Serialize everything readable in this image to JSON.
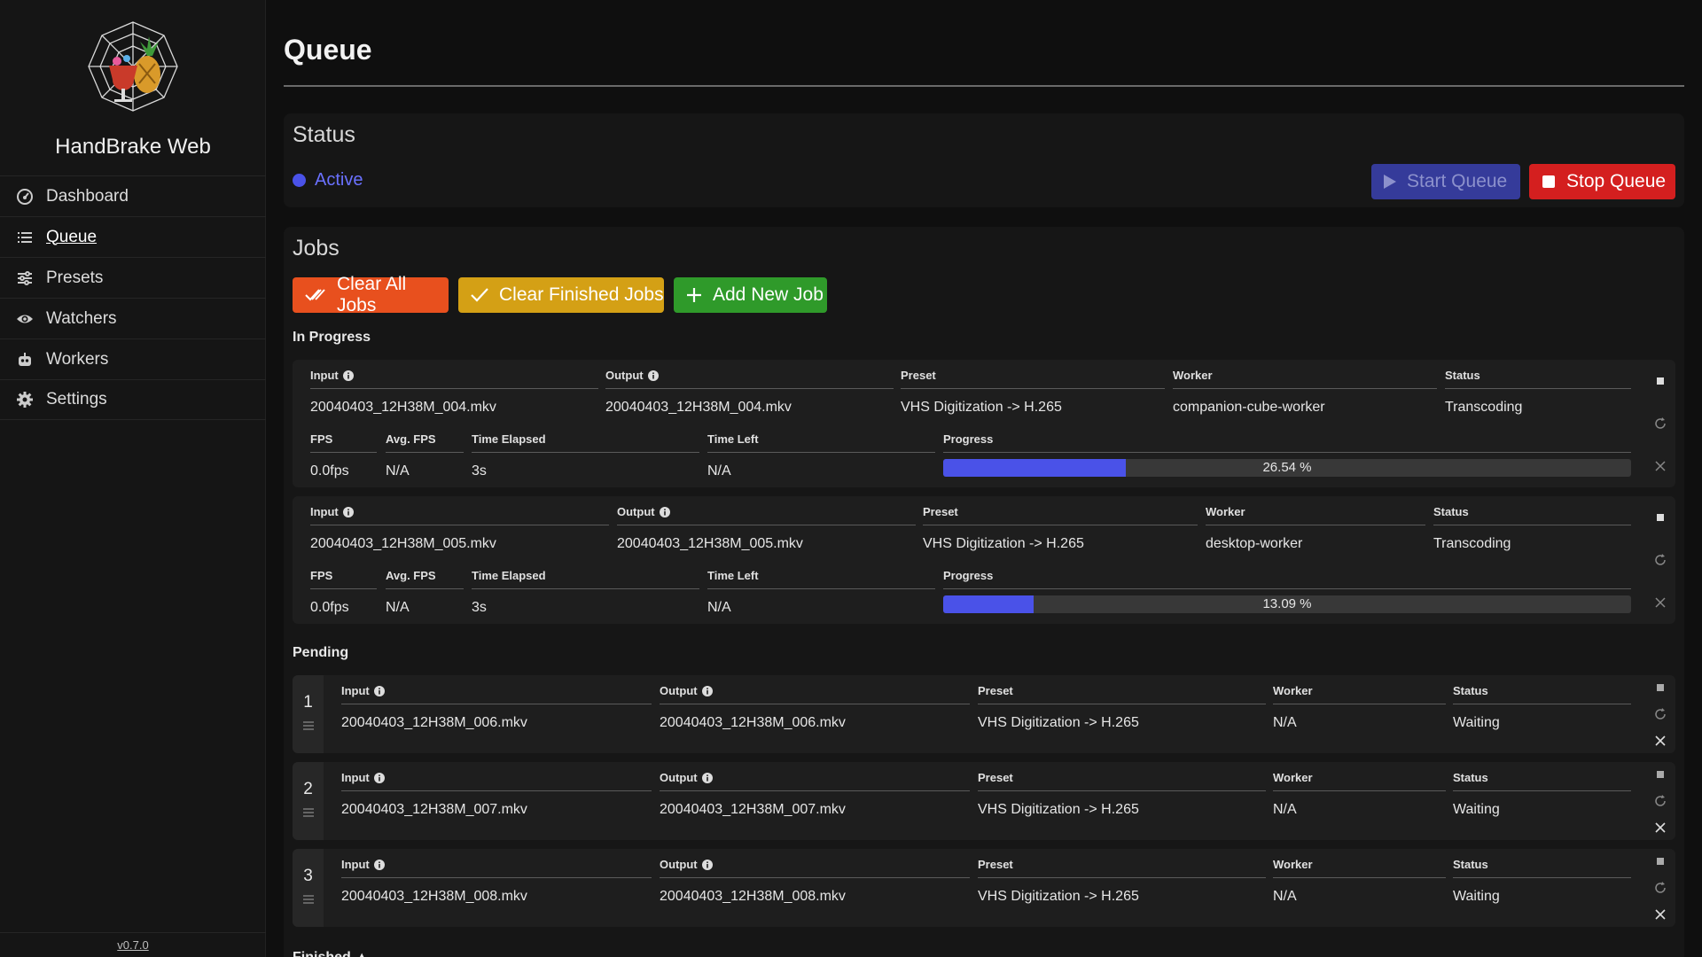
{
  "sidebar": {
    "app_name": "HandBrake Web",
    "items": [
      {
        "label": "Dashboard",
        "icon": "dashboard-icon"
      },
      {
        "label": "Queue",
        "icon": "list-icon",
        "active": true
      },
      {
        "label": "Presets",
        "icon": "sliders-icon"
      },
      {
        "label": "Watchers",
        "icon": "eye-icon"
      },
      {
        "label": "Workers",
        "icon": "robot-icon"
      },
      {
        "label": "Settings",
        "icon": "gear-icon"
      }
    ],
    "version": "v0.7.0"
  },
  "page": {
    "title": "Queue"
  },
  "status": {
    "title": "Status",
    "state": "Active",
    "start_label": "Start Queue",
    "stop_label": "Stop Queue"
  },
  "jobs": {
    "title": "Jobs",
    "clear_all_label": "Clear All Jobs",
    "clear_finished_label": "Clear Finished Jobs",
    "add_label": "Add New Job",
    "in_progress_label": "In Progress",
    "pending_label": "Pending",
    "finished_label": "Finished ▲",
    "headers": {
      "input": "Input",
      "output": "Output",
      "preset": "Preset",
      "worker": "Worker",
      "status": "Status",
      "fps": "FPS",
      "avg_fps": "Avg. FPS",
      "time_elapsed": "Time Elapsed",
      "time_left": "Time Left",
      "progress": "Progress"
    },
    "in_progress": [
      {
        "input": "20040403_12H38M_004.mkv",
        "output": "20040403_12H38M_004.mkv",
        "preset": "VHS Digitization -> H.265",
        "worker": "companion-cube-worker",
        "status": "Transcoding",
        "fps": "0.0fps",
        "avg_fps": "N/A",
        "time_elapsed": "3s",
        "time_left": "N/A",
        "progress_text": "26.54 %",
        "progress": 26.54
      },
      {
        "input": "20040403_12H38M_005.mkv",
        "output": "20040403_12H38M_005.mkv",
        "preset": "VHS Digitization -> H.265",
        "worker": "desktop-worker",
        "status": "Transcoding",
        "fps": "0.0fps",
        "avg_fps": "N/A",
        "time_elapsed": "3s",
        "time_left": "N/A",
        "progress_text": "13.09 %",
        "progress": 13.09
      }
    ],
    "pending": [
      {
        "number": "1",
        "input": "20040403_12H38M_006.mkv",
        "output": "20040403_12H38M_006.mkv",
        "preset": "VHS Digitization -> H.265",
        "worker": "N/A",
        "status": "Waiting"
      },
      {
        "number": "2",
        "input": "20040403_12H38M_007.mkv",
        "output": "20040403_12H38M_007.mkv",
        "preset": "VHS Digitization -> H.265",
        "worker": "N/A",
        "status": "Waiting"
      },
      {
        "number": "3",
        "input": "20040403_12H38M_008.mkv",
        "output": "20040403_12H38M_008.mkv",
        "preset": "VHS Digitization -> H.265",
        "worker": "N/A",
        "status": "Waiting"
      }
    ]
  },
  "colors": {
    "accent": "#4a52e8",
    "danger": "#d41f1f",
    "warning": "#d4a015",
    "success": "#2f9a2a",
    "orange": "#e8501e"
  }
}
